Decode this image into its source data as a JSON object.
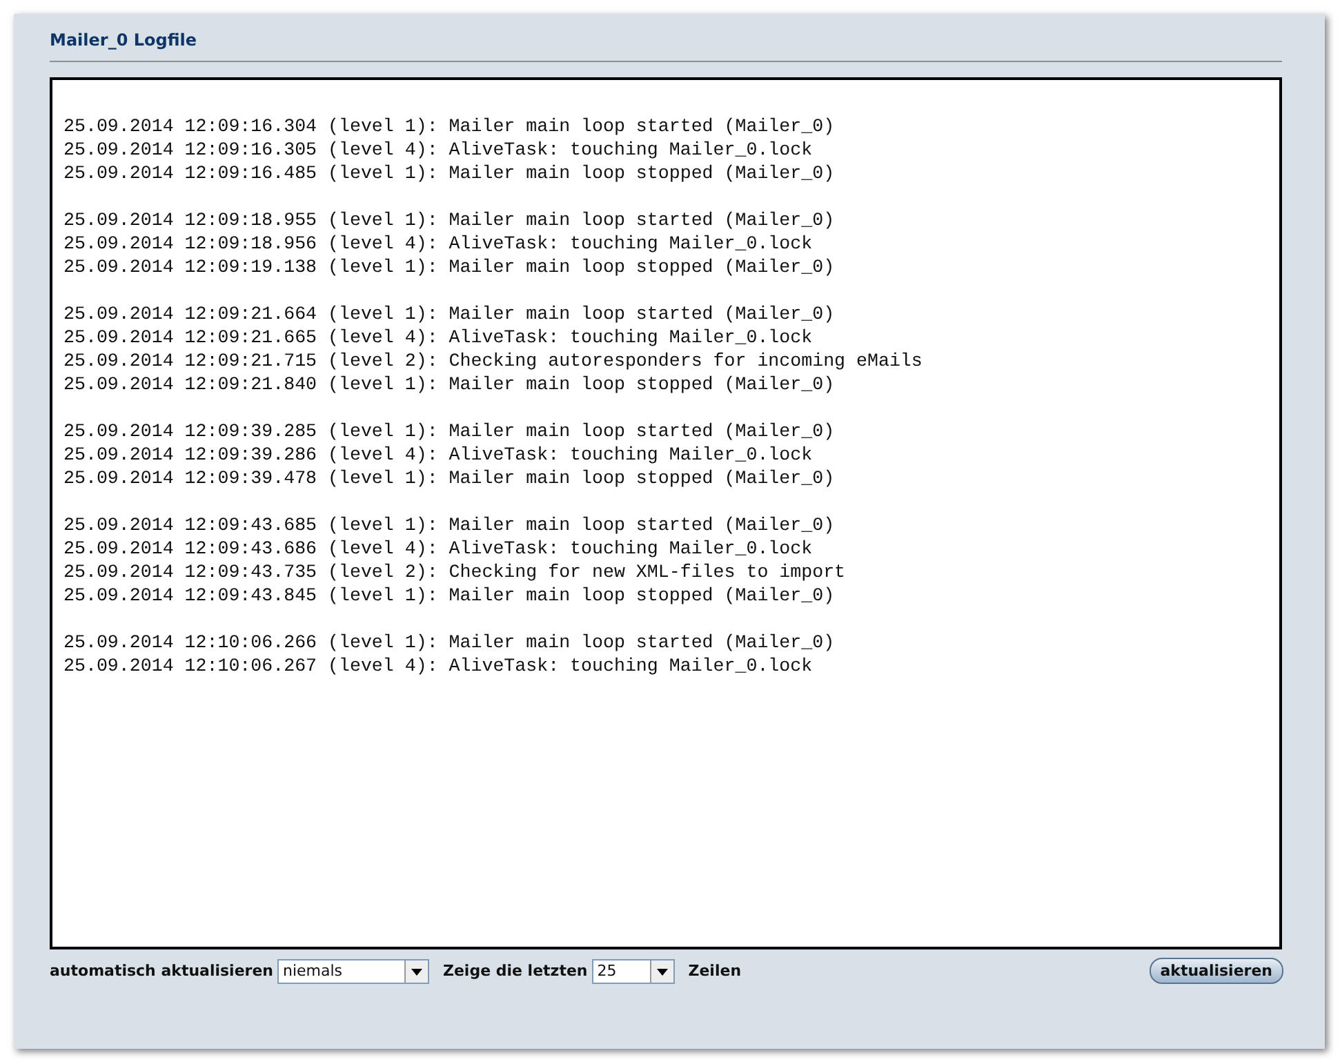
{
  "title": "Mailer_0 Logfile",
  "log_blocks": [
    {
      "lines": [
        "25.09.2014 12:09:16.304 (level 1): Mailer main loop started (Mailer_0)",
        "25.09.2014 12:09:16.305 (level 4): AliveTask: touching Mailer_0.lock",
        "25.09.2014 12:09:16.485 (level 1): Mailer main loop stopped (Mailer_0)"
      ]
    },
    {
      "lines": [
        "25.09.2014 12:09:18.955 (level 1): Mailer main loop started (Mailer_0)",
        "25.09.2014 12:09:18.956 (level 4): AliveTask: touching Mailer_0.lock",
        "25.09.2014 12:09:19.138 (level 1): Mailer main loop stopped (Mailer_0)"
      ]
    },
    {
      "lines": [
        "25.09.2014 12:09:21.664 (level 1): Mailer main loop started (Mailer_0)",
        "25.09.2014 12:09:21.665 (level 4): AliveTask: touching Mailer_0.lock",
        "25.09.2014 12:09:21.715 (level 2): Checking autoresponders for incoming eMails",
        "25.09.2014 12:09:21.840 (level 1): Mailer main loop stopped (Mailer_0)"
      ]
    },
    {
      "lines": [
        "25.09.2014 12:09:39.285 (level 1): Mailer main loop started (Mailer_0)",
        "25.09.2014 12:09:39.286 (level 4): AliveTask: touching Mailer_0.lock",
        "25.09.2014 12:09:39.478 (level 1): Mailer main loop stopped (Mailer_0)"
      ]
    },
    {
      "lines": [
        "25.09.2014 12:09:43.685 (level 1): Mailer main loop started (Mailer_0)",
        "25.09.2014 12:09:43.686 (level 4): AliveTask: touching Mailer_0.lock",
        "25.09.2014 12:09:43.735 (level 2): Checking for new XML-files to import",
        "25.09.2014 12:09:43.845 (level 1): Mailer main loop stopped (Mailer_0)"
      ]
    },
    {
      "lines": [
        "25.09.2014 12:10:06.266 (level 1): Mailer main loop started (Mailer_0)",
        "25.09.2014 12:10:06.267 (level 4): AliveTask: touching Mailer_0.lock"
      ]
    }
  ],
  "controls": {
    "auto_refresh_label": "automatisch aktualisieren",
    "auto_refresh_value": "niemals",
    "show_last_label": "Zeige die letzten",
    "show_last_value": "25",
    "lines_label": "Zeilen",
    "refresh_button": "aktualisieren"
  }
}
